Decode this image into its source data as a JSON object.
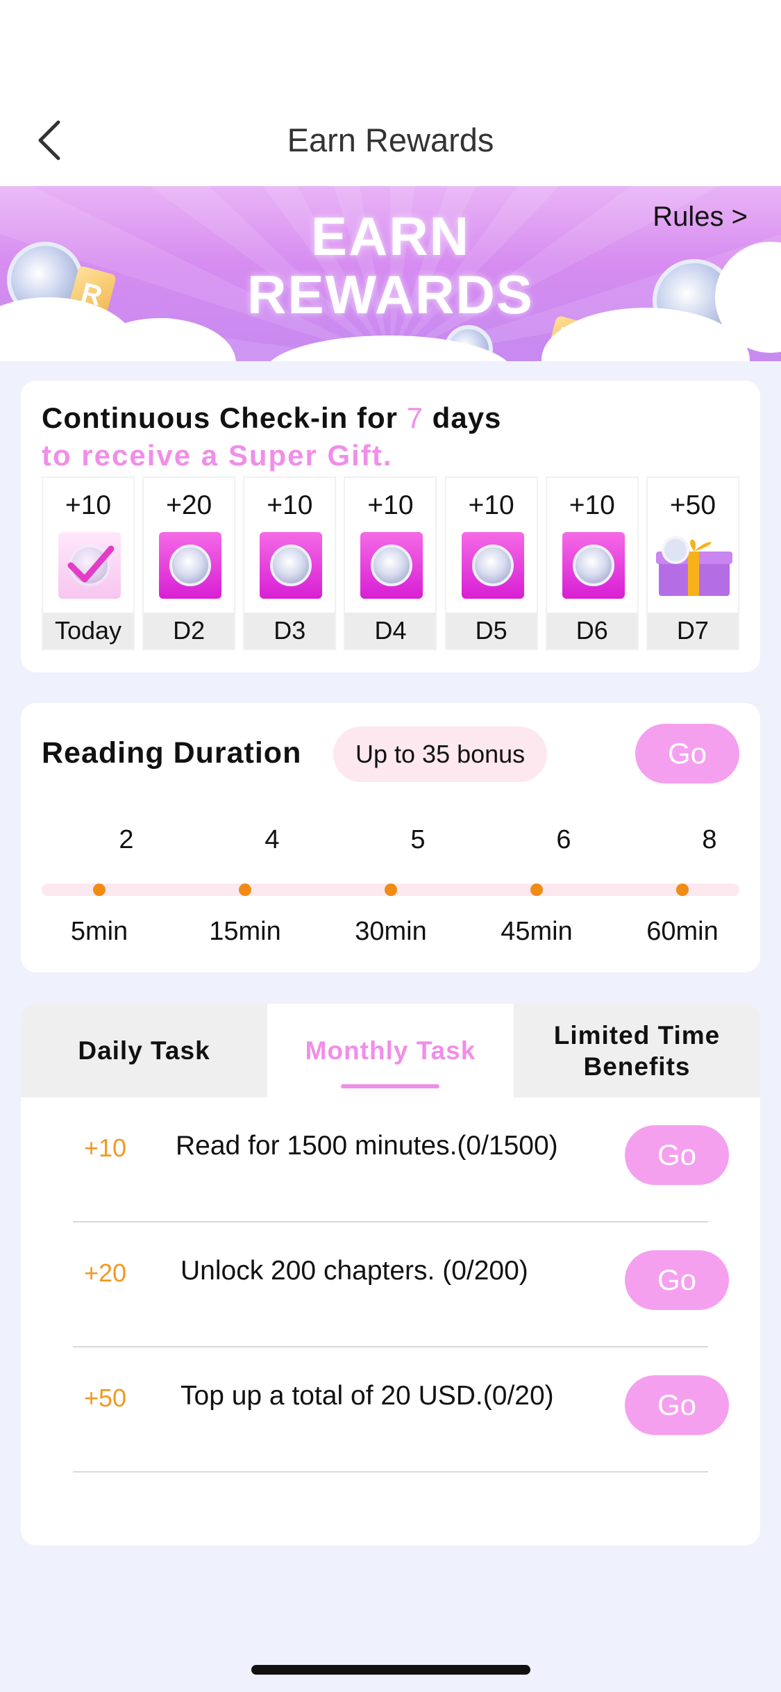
{
  "nav": {
    "title": "Earn Rewards"
  },
  "banner": {
    "title_line1": "EARN",
    "title_line2": "REWARDS",
    "rules_link": "Rules >"
  },
  "checkin": {
    "title_prefix": "Continuous Check-in for ",
    "title_days": "7",
    "title_suffix": " days",
    "subtitle": "to receive a Super Gift.",
    "days": [
      {
        "points": "+10",
        "label": "Today",
        "icon": "check-icon"
      },
      {
        "points": "+20",
        "label": "D2",
        "icon": "coin-icon"
      },
      {
        "points": "+10",
        "label": "D3",
        "icon": "coin-icon"
      },
      {
        "points": "+10",
        "label": "D4",
        "icon": "coin-icon"
      },
      {
        "points": "+10",
        "label": "D5",
        "icon": "coin-icon"
      },
      {
        "points": "+10",
        "label": "D6",
        "icon": "coin-icon"
      },
      {
        "points": "+50",
        "label": "D7",
        "icon": "gift-icon"
      }
    ]
  },
  "reading": {
    "title": "Reading Duration",
    "bonus": "Up to 35 bonus",
    "go_label": "Go",
    "steps": [
      {
        "points": "2",
        "time": "5min"
      },
      {
        "points": "4",
        "time": "15min"
      },
      {
        "points": "5",
        "time": "30min"
      },
      {
        "points": "6",
        "time": "45min"
      },
      {
        "points": "8",
        "time": "60min"
      }
    ]
  },
  "tasks": {
    "tabs": [
      {
        "label": "Daily Task",
        "active": false
      },
      {
        "label": "Monthly Task",
        "active": true
      },
      {
        "label": "Limited Time Benefits",
        "active": false
      }
    ],
    "items": [
      {
        "points": "+10",
        "text": "Read for 1500 minutes.(0/1500)",
        "go_label": "Go"
      },
      {
        "points": "+20",
        "text": "Unlock 200 chapters. (0/200)",
        "go_label": "Go"
      },
      {
        "points": "+50",
        "text": "Top up a total of 20 USD.(0/20)",
        "go_label": "Go"
      }
    ]
  },
  "colors": {
    "accent_pink": "#f08ee8",
    "go_button": "#f5a0ef",
    "points_orange": "#f09a23",
    "dot_orange": "#f08b14"
  }
}
